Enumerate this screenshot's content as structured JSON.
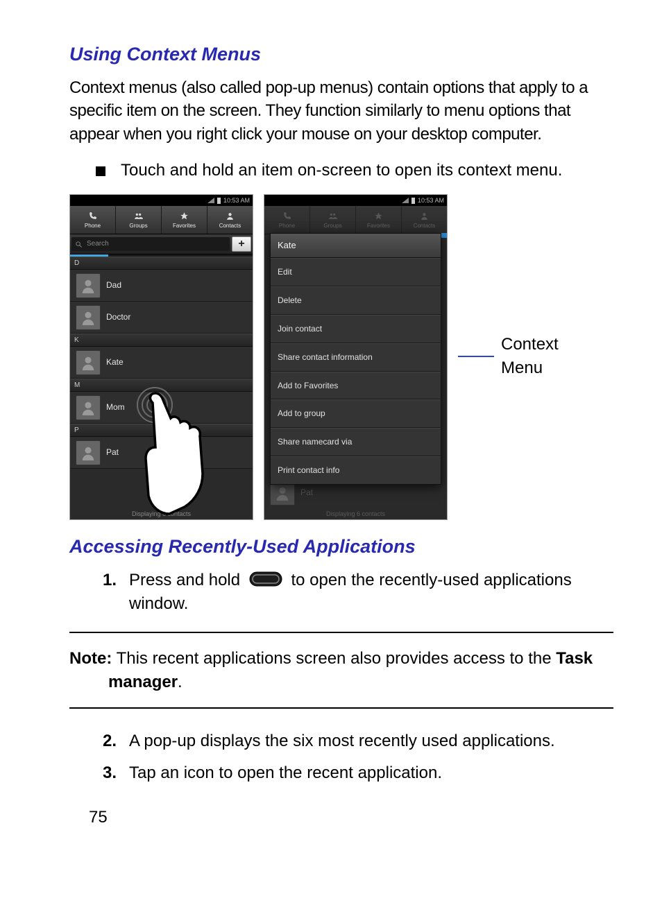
{
  "headings": {
    "context_menus": "Using Context Menus",
    "recent_apps": "Accessing Recently-Used Applications"
  },
  "paragraphs": {
    "ctx_intro": "Context menus (also called pop-up menus) contain options that apply to a specific item on the screen. They function similarly to menu options that appear when you right click your mouse on your desktop computer.",
    "ctx_bullet": "Touch and hold an item on-screen to open its context menu."
  },
  "figure": {
    "status_time": "10:53 AM",
    "tabs": [
      "Phone",
      "Groups",
      "Favorites",
      "Contacts"
    ],
    "search_placeholder": "Search",
    "contacts": {
      "D": [
        "Dad",
        "Doctor"
      ],
      "K": [
        "Kate"
      ],
      "M": [
        "Mom"
      ],
      "P": [
        "Pat"
      ]
    },
    "footer_left": "Displaying 6 contacts",
    "context_menu": {
      "title": "Kate",
      "items": [
        "Edit",
        "Delete",
        "Join contact",
        "Share contact information",
        "Add to Favorites",
        "Add to group",
        "Share namecard via",
        "Print contact info"
      ]
    },
    "bg_contact_right": "Pat",
    "footer_right": "Displaying 6 contacts",
    "callout_label": "Context Menu"
  },
  "steps": {
    "step1_before": "Press and hold ",
    "step1_after": " to open the recently-used applications window.",
    "step2": "A pop-up displays the six most recently used applications.",
    "step3": "Tap an icon to open the recent application."
  },
  "note": {
    "label": "Note:",
    "text_before": " This recent applications screen also provides access to the ",
    "bold_term": "Task manager",
    "text_after": "."
  },
  "page_number": "75"
}
